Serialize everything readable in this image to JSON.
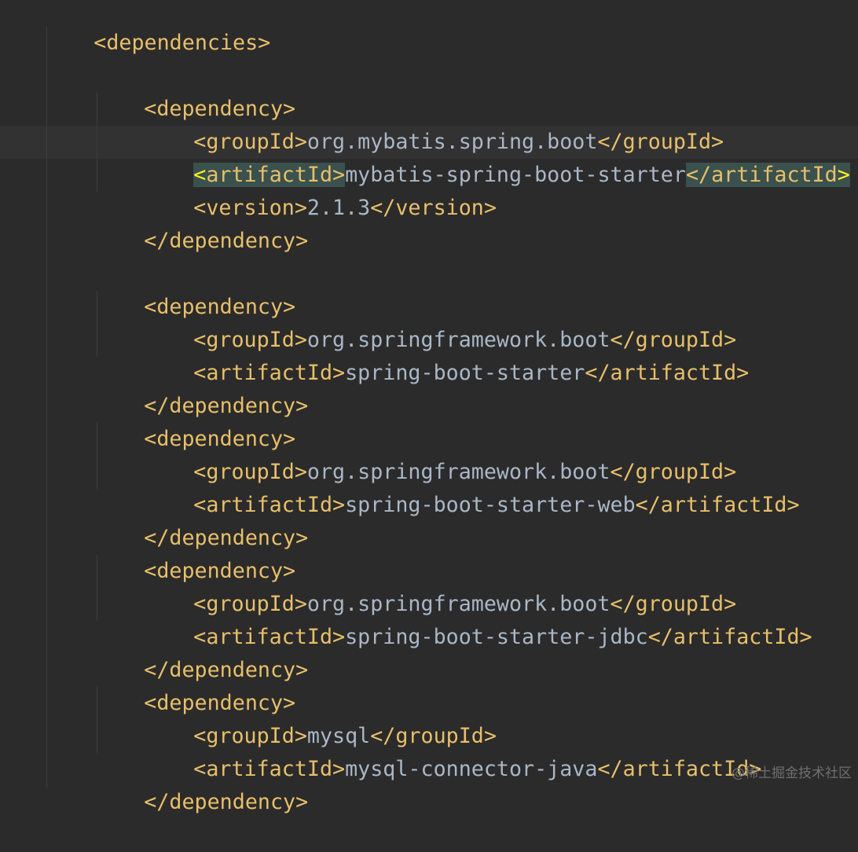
{
  "editor": {
    "language": "xml",
    "colors": {
      "background": "#2b2b2b",
      "tag": "#e8bf6a",
      "text": "#a9b7c6",
      "match_highlight": "#3b514d",
      "caret_bracket": "#ffef28"
    },
    "lines": [
      {
        "open": "<dependencies>"
      },
      {
        "blank": ""
      },
      {
        "open": "<dependency>"
      },
      {
        "open": "<groupId>",
        "value": "org.mybatis.spring.boot",
        "close": "</groupId>"
      },
      {
        "open": "<artifactId>",
        "value": "mybatis-spring-boot-starter",
        "close": "</artifactId>"
      },
      {
        "open": "<version>",
        "value": "2.1.3",
        "close": "</version>"
      },
      {
        "open": "</dependency>"
      },
      {
        "blank": ""
      },
      {
        "open": "<dependency>"
      },
      {
        "open": "<groupId>",
        "value": "org.springframework.boot",
        "close": "</groupId>"
      },
      {
        "open": "<artifactId>",
        "value": "spring-boot-starter",
        "close": "</artifactId>"
      },
      {
        "open": "</dependency>"
      },
      {
        "open": "<dependency>"
      },
      {
        "open": "<groupId>",
        "value": "org.springframework.boot",
        "close": "</groupId>"
      },
      {
        "open": "<artifactId>",
        "value": "spring-boot-starter-web",
        "close": "</artifactId>"
      },
      {
        "open": "</dependency>"
      },
      {
        "open": "<dependency>"
      },
      {
        "open": "<groupId>",
        "value": "org.springframework.boot",
        "close": "</groupId>"
      },
      {
        "open": "<artifactId>",
        "value": "spring-boot-starter-jdbc",
        "close": "</artifactId>"
      },
      {
        "open": "</dependency>"
      },
      {
        "open": "<dependency>"
      },
      {
        "open": "<groupId>",
        "value": "mysql",
        "close": "</groupId>"
      },
      {
        "open": "<artifactId>",
        "value": "mysql-connector-java",
        "close": "</artifactId>"
      },
      {
        "open": "</dependency>"
      }
    ],
    "highlighted_line": {
      "bracket": "<",
      "open_rest": "artifactId>",
      "value": "mybatis-spring-boot-starter",
      "close_rest": "</artifactId",
      "close_bracket": ">"
    }
  },
  "watermark": "@稀土掘金技术社区"
}
